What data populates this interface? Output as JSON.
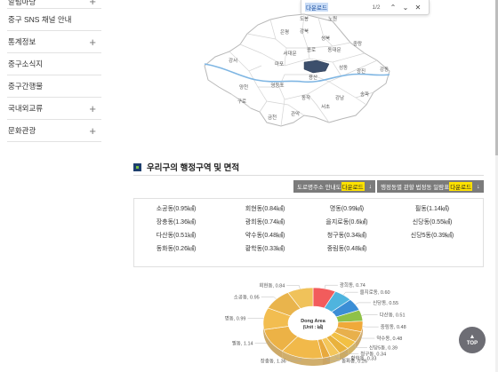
{
  "sidebar": {
    "items": [
      {
        "label": "알림마당",
        "expandable": true
      },
      {
        "label": "중구 SNS 채널 안내",
        "expandable": false
      },
      {
        "label": "통계정보",
        "expandable": true
      },
      {
        "label": "중구소식지",
        "expandable": false
      },
      {
        "label": "중구간행물",
        "expandable": false
      },
      {
        "label": "국내외교류",
        "expandable": true
      },
      {
        "label": "문화관광",
        "expandable": true
      }
    ],
    "plus_symbol": "+"
  },
  "find_bar": {
    "query": "다운로드",
    "count": "1/2",
    "prev_symbol": "⌃",
    "next_symbol": "⌄",
    "close_symbol": "✕"
  },
  "map": {
    "districts": [
      "도봉",
      "노원",
      "강북",
      "은평",
      "성북",
      "중랑",
      "종로",
      "동대문",
      "서대문",
      "강서",
      "마포",
      "중구",
      "성동",
      "광진",
      "강동",
      "용산",
      "양천",
      "영등포",
      "동작",
      "송파",
      "구로",
      "강남",
      "서초",
      "금천",
      "관악"
    ],
    "highlight_color": "#3c4f6c"
  },
  "section": {
    "title": "우리구의 행정구역 및 면적",
    "btn1_label": "도로명주소 안내도",
    "btn1_highlight": "다운로드",
    "btn2_label": "행정동별 관할 법정동 일람표",
    "btn2_highlight": "다운로드",
    "download_icon": "↓"
  },
  "areas": [
    [
      "소공동(0.95㎢)",
      "회현동(0.84㎢)",
      "명동(0.99㎢)",
      "필동(1.14㎢)"
    ],
    [
      "장충동(1.36㎢)",
      "광희동(0.74㎢)",
      "을지로동(0.6㎢)",
      "신당동(0.55㎢)"
    ],
    [
      "다산동(0.51㎢)",
      "약수동(0.48㎢)",
      "청구동(0.34㎢)",
      "신당5동(0.39㎢)"
    ],
    [
      "동화동(0.26㎢)",
      "황학동(0.33㎢)",
      "중림동(0.48㎢)"
    ]
  ],
  "chart_data": {
    "type": "pie",
    "title": "Dong Area (Unit : ㎢)",
    "categories": [
      "광희동",
      "을지로동",
      "신당동",
      "다산동",
      "중림동",
      "약수동",
      "신당5동",
      "청구동",
      "황학동",
      "동화동",
      "장충동",
      "필동",
      "명동",
      "소공동",
      "회현동"
    ],
    "values": [
      0.74,
      0.6,
      0.55,
      0.51,
      0.48,
      0.48,
      0.39,
      0.34,
      0.33,
      0.26,
      1.36,
      1.14,
      0.99,
      0.95,
      0.84
    ],
    "labels": [
      "광희동, 0.74",
      "을지로동, 0.60",
      "신당동, 0.55",
      "다산동, 0.51",
      "중림동, 0.48",
      "약수동, 0.48",
      "신당5동, 0.39",
      "청구동, 0.34",
      "황학동, 0.33",
      "동화동, 0.26",
      "장충동, 1.36",
      "필동, 1.14",
      "명동, 0.99",
      "소공동, 0.95",
      "회현동, 0.84"
    ],
    "colors": [
      "#f25c5c",
      "#4fb4de",
      "#3b8ed6",
      "#8fc148",
      "#f0a93a",
      "#e8b04c",
      "#f2c044",
      "#e9b23d",
      "#f4c65a",
      "#e8a93d",
      "#f1b94a",
      "#ecb246",
      "#f2bd50",
      "#e9b44c",
      "#f0c25a"
    ]
  },
  "top_button": {
    "arrow": "▲",
    "label": "TOP"
  }
}
